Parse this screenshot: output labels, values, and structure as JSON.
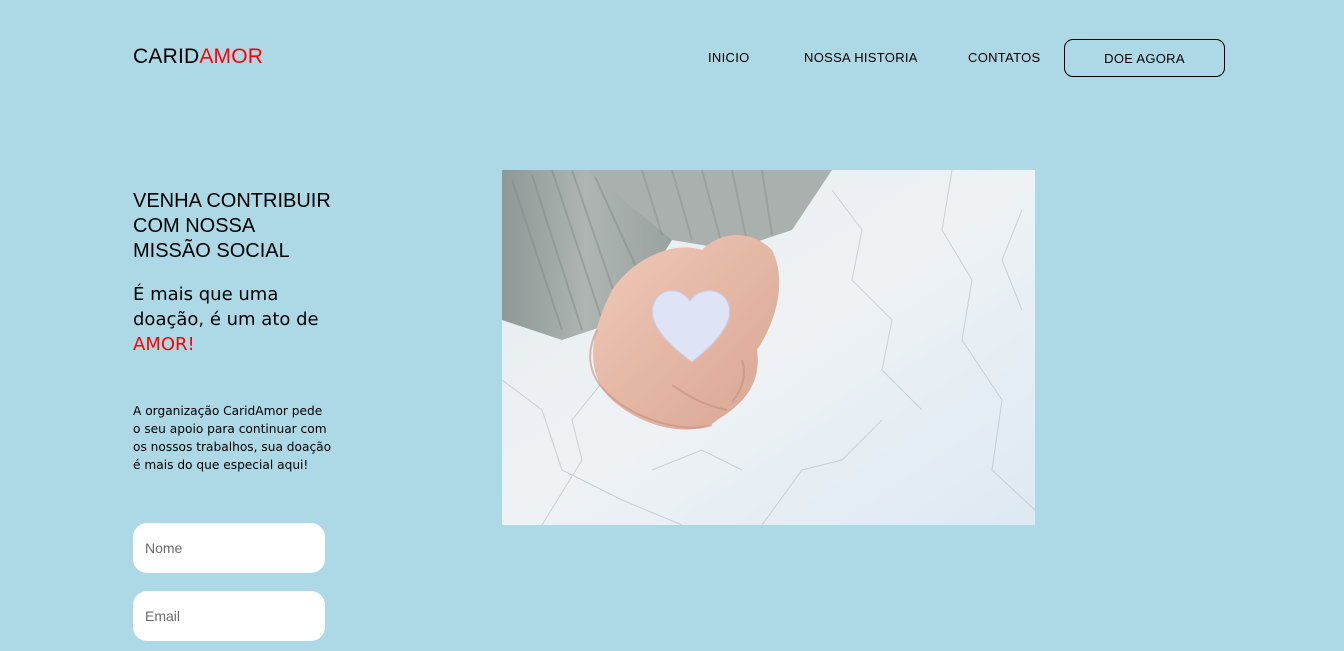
{
  "header": {
    "logo_part1": "CARID",
    "logo_part2": "AMOR",
    "nav": {
      "inicio": "INICIO",
      "historia": "NOSSA HISTORIA",
      "contatos": "CONTATOS"
    },
    "donate_button": "DOE AGORA"
  },
  "hero": {
    "headline_line1": "VENHA CONTRIBUIR",
    "headline_line2": "COM NOSSA",
    "headline_line3": "MISSÃO SOCIAL",
    "sub_line1": "É mais que uma",
    "sub_line2": "doação, é um ato de",
    "sub_accent": "AMOR!",
    "description": "A organização CaridAmor pede o seu apoio para continuar com os nossos trabalhos, sua doação é mais do que especial aqui!"
  },
  "form": {
    "name_placeholder": "Nome",
    "email_placeholder": "Email"
  },
  "colors": {
    "background": "#add8e6",
    "accent": "#ff0000",
    "field_background": "#ffffff"
  }
}
